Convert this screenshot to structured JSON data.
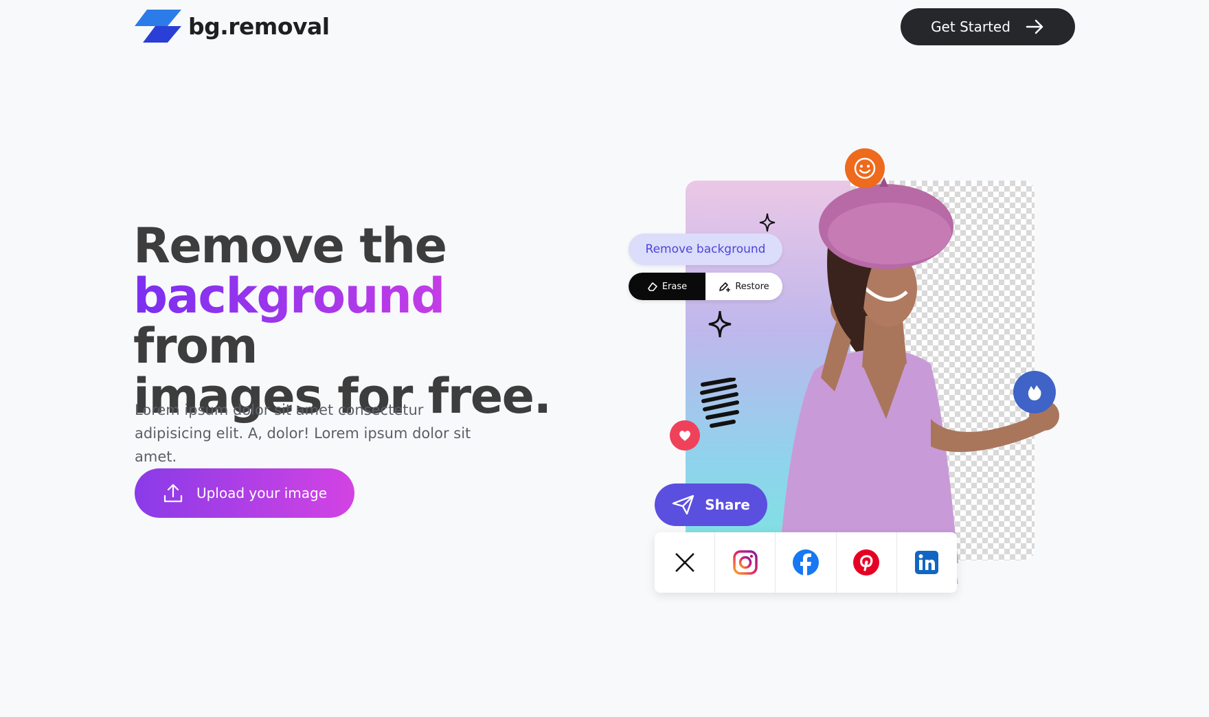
{
  "brand": {
    "name": "bg.removal"
  },
  "header": {
    "cta_label": "Get Started"
  },
  "hero": {
    "title_line1": "Remove the",
    "title_highlight": "background",
    "title_after_highlight": " from",
    "title_line3": "images for free.",
    "description": "Lorem ipsum dolor sit amet consectetur adipisicing elit. A, dolor! Lorem ipsum dolor sit amet.",
    "upload_label": "Upload your image"
  },
  "illustration": {
    "remove_bg_label": "Remove background",
    "erase_label": "Erase",
    "restore_label": "Restore",
    "share_label": "Share",
    "social_icons": [
      "x-icon",
      "instagram-icon",
      "facebook-icon",
      "pinterest-icon",
      "linkedin-icon"
    ]
  },
  "colors": {
    "accent_purple": "#8a3be8",
    "accent_pink": "#d343e3",
    "logo_blue": "#2251f0",
    "dark_button": "#26272b",
    "share_blue": "#5b4fe0"
  }
}
